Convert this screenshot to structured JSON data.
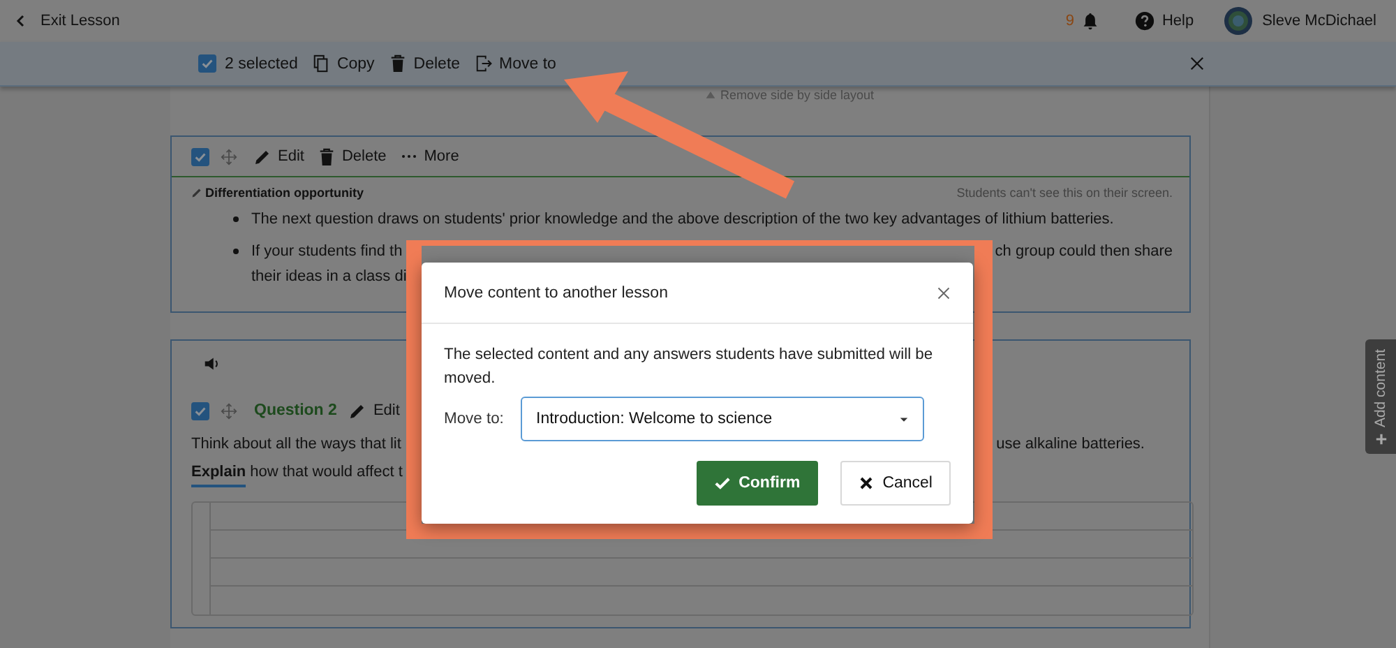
{
  "header": {
    "back_label": "Exit Lesson",
    "notification_count": "9",
    "help_label": "Help",
    "user_name": "Sleve McDichael"
  },
  "selection_bar": {
    "checked": true,
    "count_label": "2 selected",
    "actions": [
      {
        "kind": "copy",
        "label": "Copy"
      },
      {
        "kind": "delete",
        "label": "Delete"
      },
      {
        "kind": "move",
        "label": "Move to"
      }
    ]
  },
  "layout_link": "Remove side by side layout",
  "block_1": {
    "checked": true,
    "actions": [
      {
        "kind": "edit",
        "label": "Edit"
      },
      {
        "kind": "delete",
        "label": "Delete"
      },
      {
        "kind": "more",
        "label": "More"
      }
    ],
    "note": {
      "title": "Differentiation opportunity",
      "visibility": "Students can't see this on their screen.",
      "bullets": [
        {
          "lines": [
            [
              "The next question draws on students' prior knowledge and the above description of the two key advantages of lithium batteries."
            ]
          ]
        },
        {
          "lines": [
            [
              "If your students find th",
              "ch group could then share"
            ],
            [
              "their ideas in a class di"
            ]
          ]
        }
      ]
    }
  },
  "block_2": {
    "checked": true,
    "title": "Question 2",
    "edit_label": "Edit",
    "lines": [
      {
        "left": "Think about all the ways that lit",
        "right": "use alkaline batteries."
      },
      {
        "keyword": "Explain",
        "left": "how that would affect t"
      }
    ]
  },
  "add_content": "Add content",
  "dialog": {
    "title": "Move content to another lesson",
    "message": "The selected content and any answers students have submitted will be moved.",
    "field_label": "Move to:",
    "field_value": "Introduction: Welcome to science",
    "buttons": [
      {
        "kind": "primary",
        "label": "Confirm"
      },
      {
        "kind": "secondary",
        "label": "Cancel"
      }
    ]
  }
}
